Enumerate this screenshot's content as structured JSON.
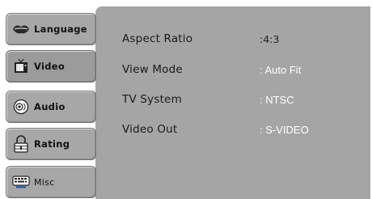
{
  "sidebar": {
    "tabs": [
      {
        "label": "Language",
        "icon": "lips-icon"
      },
      {
        "label": "Video",
        "icon": "tv-icon"
      },
      {
        "label": "Audio",
        "icon": "speaker-icon"
      },
      {
        "label": "Rating",
        "icon": "padlock-icon"
      },
      {
        "label": "Misc",
        "icon": "keyboard-icon"
      }
    ],
    "selected": "Video"
  },
  "settings": [
    {
      "name": "Aspect Ratio",
      "value": ":4:3"
    },
    {
      "name": "View Mode",
      "value": ": Auto Fit"
    },
    {
      "name": "TV System",
      "value": ": NTSC"
    },
    {
      "name": "Video Out",
      "value": ": S-VIDEO"
    }
  ]
}
